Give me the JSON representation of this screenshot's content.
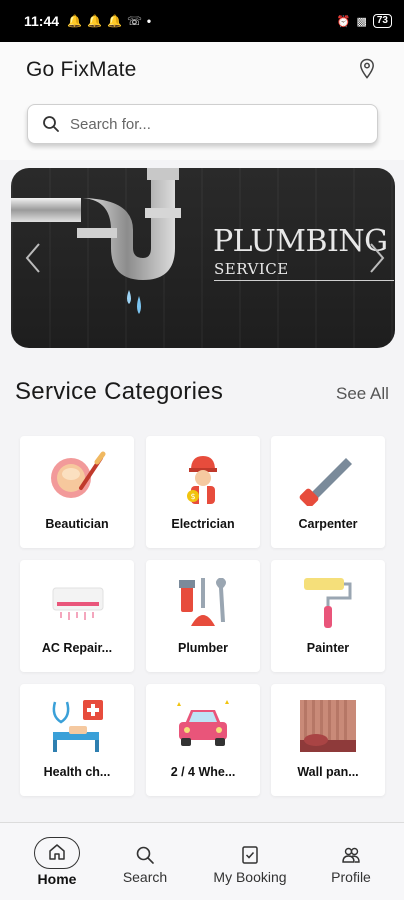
{
  "status_bar": {
    "time": "11:44",
    "battery": "73",
    "left_icons": [
      "notification-icon",
      "notification-icon",
      "notification-icon",
      "whatsapp-icon",
      "dot-icon"
    ],
    "right_icons": [
      "alarm-icon",
      "signal-icon",
      "battery-icon"
    ]
  },
  "header": {
    "title": "Go FixMate",
    "location_icon": "location-pin-icon"
  },
  "search": {
    "placeholder": "Search for..."
  },
  "banner": {
    "title": "PLUMBING",
    "subtitle": "SERVICE"
  },
  "categories_section": {
    "title": "Service Categories",
    "see_all": "See All"
  },
  "categories": [
    {
      "label": "Beautician",
      "icon": "makeup-compact-icon"
    },
    {
      "label": "Electrician",
      "icon": "electrician-icon"
    },
    {
      "label": "Carpenter",
      "icon": "saw-icon"
    },
    {
      "label": "AC Repair...",
      "icon": "air-conditioner-icon"
    },
    {
      "label": "Plumber",
      "icon": "plumbing-tools-icon"
    },
    {
      "label": "Painter",
      "icon": "paint-roller-icon"
    },
    {
      "label": "Health ch...",
      "icon": "health-checkup-icon"
    },
    {
      "label": "2 / 4 Whe...",
      "icon": "car-icon"
    },
    {
      "label": "Wall pan...",
      "icon": "wall-panel-icon"
    }
  ],
  "bottom_nav": {
    "items": [
      {
        "label": "Home",
        "icon": "home-icon"
      },
      {
        "label": "Search",
        "icon": "search-icon"
      },
      {
        "label": "My Booking",
        "icon": "booking-icon"
      },
      {
        "label": "Profile",
        "icon": "profile-icon"
      }
    ]
  },
  "colors": {
    "accent_pink": "#e9557a",
    "status_bar_bg": "#000000",
    "page_bg": "#f4f4f6"
  }
}
